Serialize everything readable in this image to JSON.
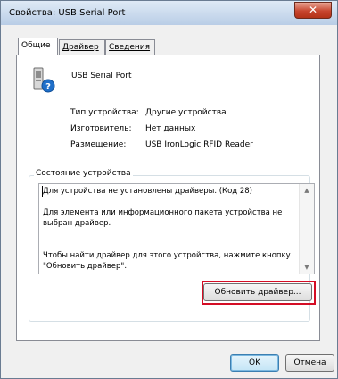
{
  "window": {
    "title": "Свойства: USB Serial Port"
  },
  "tabs": [
    {
      "label": "Общие"
    },
    {
      "label": "Драйвер"
    },
    {
      "label": "Сведения"
    }
  ],
  "device": {
    "name": "USB Serial Port",
    "icon": "usb-device-question-icon"
  },
  "properties": [
    {
      "label": "Тип устройства:",
      "value": "Другие устройства"
    },
    {
      "label": "Изготовитель:",
      "value": "Нет данных"
    },
    {
      "label": "Размещение:",
      "value": "USB IronLogic RFID Reader"
    }
  ],
  "status": {
    "group_label": "Состояние устройства",
    "text": "Для устройства не установлены драйверы. (Код 28)\n\nДля элемента или информационного пакета устройства не\nвыбран драйвер.\n\n\nЧтобы найти драйвер для этого устройства, нажмите кнопку\n\"Обновить драйвер\"."
  },
  "buttons": {
    "update_driver": "Обновить драйвер...",
    "ok": "OK",
    "cancel": "Отмена"
  },
  "colors": {
    "highlight": "#d40d25",
    "close_button": "#c7452e"
  }
}
